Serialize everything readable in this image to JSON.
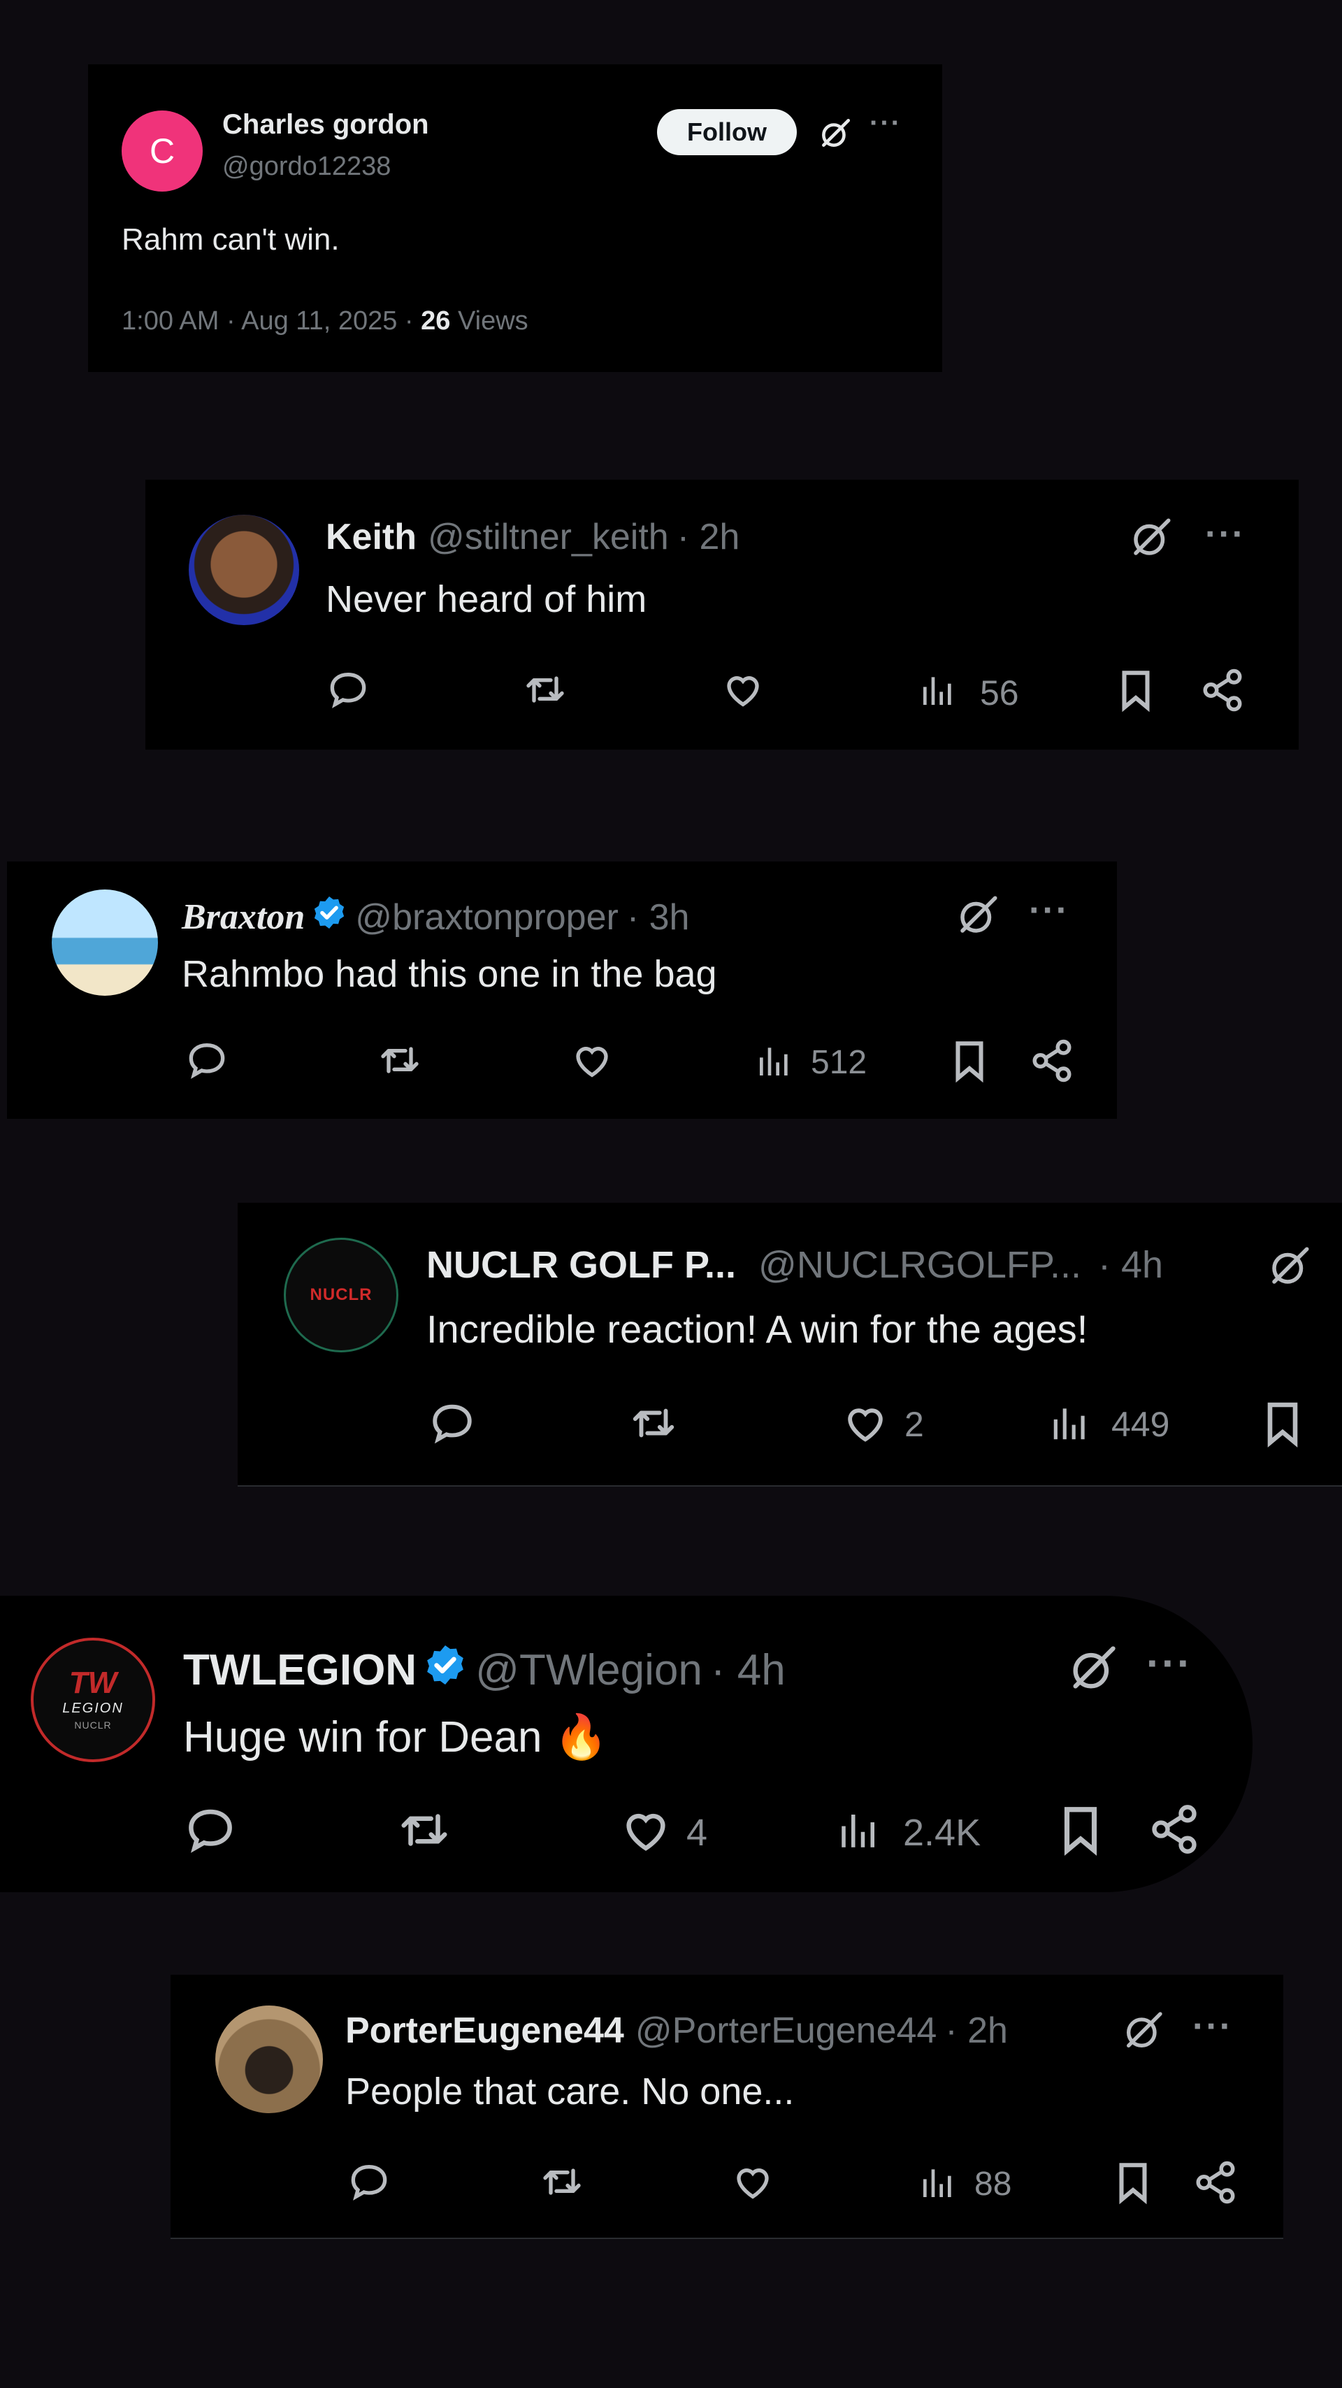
{
  "main_post": {
    "avatar_letter": "C",
    "avatar_color": "#f0337a",
    "name": "Charles gordon",
    "handle": "@gordo12238",
    "follow_label": "Follow",
    "text": "Rahm can't win.",
    "timestamp": "1:00 AM · Aug 11, 2025 · ",
    "views_count": "26",
    "views_label": " Views"
  },
  "replies": [
    {
      "name": "Keith",
      "handle": "@stiltner_keith",
      "time": "· 2h",
      "verified": false,
      "text": "Never heard of him",
      "likes": "",
      "views": "56"
    },
    {
      "name": "Braxton",
      "handle": "@braxtonproper",
      "time": "· 3h",
      "verified": true,
      "text": "Rahmbo had this one in the bag",
      "likes": "",
      "views": "512"
    },
    {
      "name": "NUCLR GOLF P...",
      "handle": "@NUCLRGOLFP...",
      "time": "· 4h",
      "verified": false,
      "text": "Incredible reaction! A win for the ages!",
      "likes": "2",
      "views": "449",
      "avatar_text": "NUCLR"
    },
    {
      "name": "TWLEGION",
      "handle": "@TWlegion",
      "time": "· 4h",
      "verified": true,
      "text": "Huge win for Dean",
      "emoji": "🔥",
      "likes": "4",
      "views": "2.4K",
      "avatar_text_top": "TW",
      "avatar_text_mid": "LEGION",
      "avatar_text_bot": "NUCLR"
    },
    {
      "name": "PorterEugene44",
      "handle": "@PorterEugene44",
      "time": "· 2h",
      "verified": false,
      "text": "People that care. No one...",
      "likes": "",
      "views": "88"
    }
  ],
  "icons": {
    "reply": "reply-icon",
    "repost": "repost-icon",
    "like": "heart-icon",
    "views": "views-icon",
    "bookmark": "bookmark-icon",
    "share": "share-icon",
    "grok": "grok-icon",
    "more": "more-icon",
    "verified": "verified-badge-icon"
  },
  "colors": {
    "background": "#0d0b10",
    "card": "#000000",
    "text": "#e7e9ea",
    "muted": "#71767b",
    "verified": "#1d9bf0"
  }
}
